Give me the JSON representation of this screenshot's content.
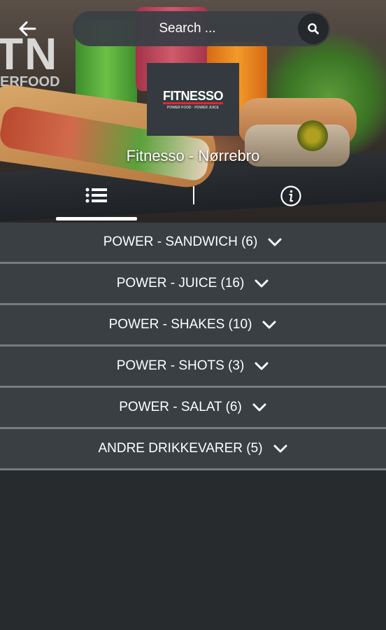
{
  "header": {
    "back_icon": "arrow-left-icon",
    "search_placeholder": "Search ...",
    "search_icon": "search-icon"
  },
  "store": {
    "logo_text": "FITNESSO",
    "logo_subtext": "POWER FOOD · POWER JUICE",
    "name": "Fitnesso - Nørrebro"
  },
  "background": {
    "letters": "TN",
    "subtext": "ERFOOD"
  },
  "tabs": [
    {
      "icon": "list-icon",
      "active": true
    },
    {
      "icon": "info-icon",
      "active": false
    }
  ],
  "categories": [
    {
      "label": "POWER - SANDWICH (6)"
    },
    {
      "label": "POWER - JUICE (16)"
    },
    {
      "label": "POWER - SHAKES (10)"
    },
    {
      "label": "POWER - SHOTS (3)"
    },
    {
      "label": "POWER - SALAT (6)"
    },
    {
      "label": "ANDRE DRIKKEVARER (5)"
    }
  ],
  "colors": {
    "row_bg": "#3a3f44",
    "row_divider": "#767b80",
    "page_bg": "#272b2e",
    "logo_accent": "#e02a2a"
  }
}
